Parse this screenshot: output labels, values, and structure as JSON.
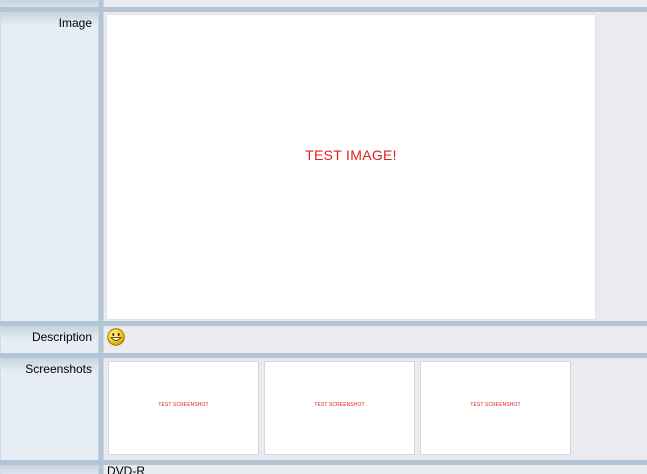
{
  "rows": {
    "image": {
      "label": "Image",
      "image_text": "TEST IMAGE!"
    },
    "description": {
      "label": "Description",
      "emoji": "smiley-face-icon"
    },
    "screenshots": {
      "label": "Screenshots",
      "items": [
        {
          "text": "TEST SCREENSHOT"
        },
        {
          "text": "TEST SCREENSHOT"
        },
        {
          "text": "TEST SCREENSHOT"
        }
      ]
    },
    "bottom": {
      "value": "DVD-R"
    }
  },
  "colors": {
    "background": "#b3c4d4",
    "label_cell": "#e6edf4",
    "value_cell": "#e9ebee",
    "image_text": "#e02020"
  }
}
